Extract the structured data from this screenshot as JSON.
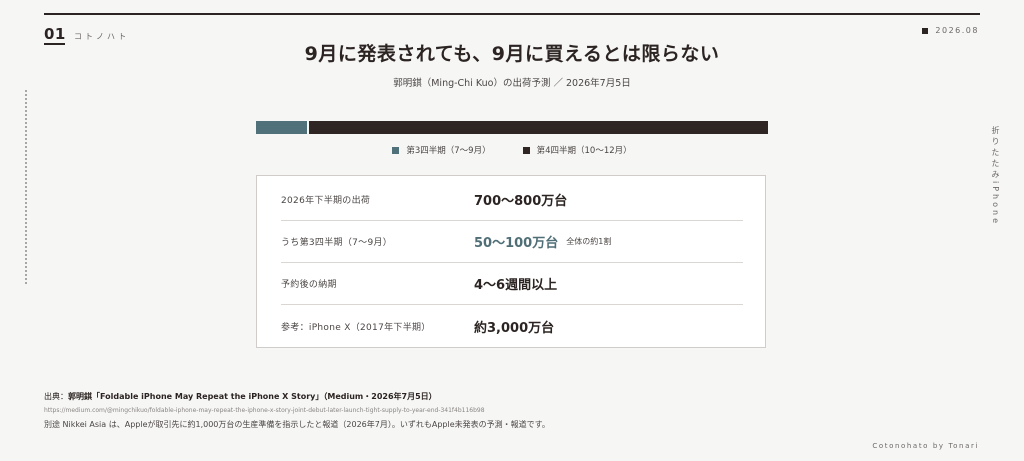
{
  "header": {
    "page_number": "01",
    "brand": "コトノハト",
    "date": "2026.08",
    "side_label": "折りたたみiPhone"
  },
  "main": {
    "title": "9月に発表されても、9月に買えるとは限らない",
    "subtitle": "郭明錤（Ming-Chi Kuo）の出荷予測 ／ 2026年7月5日"
  },
  "colors": {
    "q3": "#507179",
    "q4": "#2f2523",
    "accent_text": "#4f6e76"
  },
  "chart_data": {
    "type": "bar",
    "orientation": "horizontal-stacked",
    "series": [
      {
        "name": "第3四半期（7〜9月）",
        "value": 0.1
      },
      {
        "name": "第4四半期（10〜12月）",
        "value": 0.9
      }
    ]
  },
  "legend": [
    {
      "label": "第3四半期（7〜9月）"
    },
    {
      "label": "第4四半期（10〜12月）"
    }
  ],
  "table": {
    "rows": [
      {
        "label": "2026年下半期の出荷",
        "value": "700〜800万台",
        "note": ""
      },
      {
        "label": "うち第3四半期（7〜9月）",
        "value": "50〜100万台",
        "note": "全体の約1割"
      },
      {
        "label": "予約後の納期",
        "value": "4〜6週間以上",
        "note": ""
      },
      {
        "label": "参考：iPhone X（2017年下半期）",
        "value": "約3,000万台",
        "note": ""
      }
    ]
  },
  "source": {
    "prefix": "出典：",
    "title": "郭明錤「Foldable iPhone May Repeat the iPhone X Story」（Medium・2026年7月5日）",
    "url": "https://medium.com/@mingchikuo/foldable-iphone-may-repeat-the-iphone-x-story-joint-debut-later-launch-tight-supply-to-year-end-341f4b116b98",
    "note": "別途 Nikkei Asia は、Appleが取引先に約1,000万台の生産準備を指示したと報道（2026年7月）。いずれもApple未発表の予測・報道です。"
  },
  "footer": {
    "brand": "Cotonohato by Tonari"
  }
}
